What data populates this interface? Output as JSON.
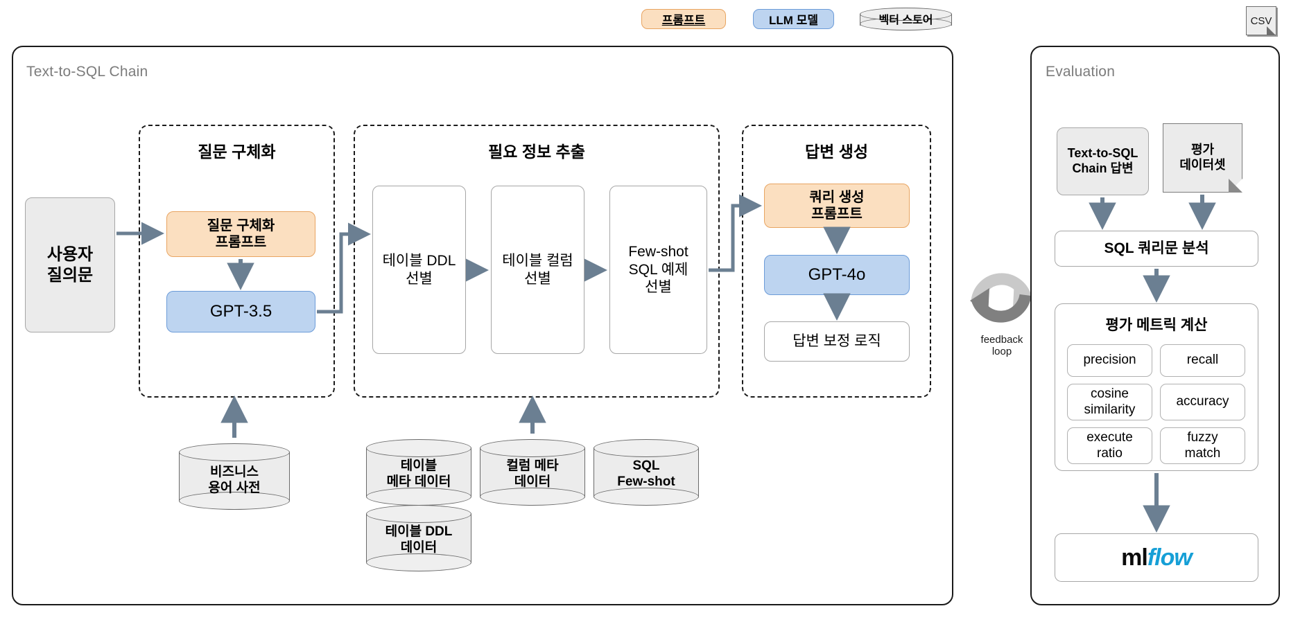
{
  "legend": {
    "items": [
      {
        "label": "프롬프트",
        "kind": "prompt"
      },
      {
        "label": "LLM 모델",
        "kind": "llm"
      },
      {
        "label": "벡터 스토어",
        "kind": "vector-store"
      }
    ],
    "csv_label": "CSV"
  },
  "chain_panel": {
    "title": "Text-to-SQL Chain",
    "user_query": "사용자\n질의문",
    "groups": {
      "clarify": {
        "title": "질문 구체화",
        "prompt_box": "질문 구체화\n프롬프트",
        "model_box": "GPT-3.5"
      },
      "retrieve": {
        "title": "필요 정보 추출",
        "steps": [
          "테이블 DDL\n선별",
          "테이블 컬럼\n선별",
          "Few-shot\nSQL 예제\n선별"
        ]
      },
      "answer": {
        "title": "답변 생성",
        "prompt_box": "쿼리 생성\n프롬프트",
        "model_box": "GPT-4o",
        "logic_box": "답변 보정 로직"
      }
    },
    "stores": [
      "비즈니스\n용어 사전",
      "테이블\n메타 데이터",
      "테이블 DDL\n데이터",
      "컬럼 메타\n데이터",
      "SQL\nFew-shot"
    ]
  },
  "feedback": {
    "label": "feedback\nloop"
  },
  "evaluation_panel": {
    "title": "Evaluation",
    "chain_answer": "Text-to-SQL\nChain 답변",
    "eval_dataset": "평가\n데이터셋",
    "analysis": "SQL 쿼리문 분석",
    "metrics_title": "평가 메트릭 계산",
    "metrics": [
      "precision",
      "recall",
      "cosine\nsimilarity",
      "accuracy",
      "execute\nratio",
      "fuzzy\nmatch"
    ],
    "tracking": {
      "prefix": "ml",
      "suffix": "flow"
    }
  },
  "colors": {
    "prompt_fill": "#fbdfc0",
    "prompt_stroke": "#e8a461",
    "llm_fill": "#bdd4f0",
    "llm_stroke": "#6b9bd8",
    "neutral_fill": "#ebebeb",
    "neutral_stroke": "#a6a6a6",
    "connector": "#6b7f92",
    "panel_stroke": "#1a1a1a",
    "mlflow_accent": "#169fd6"
  }
}
